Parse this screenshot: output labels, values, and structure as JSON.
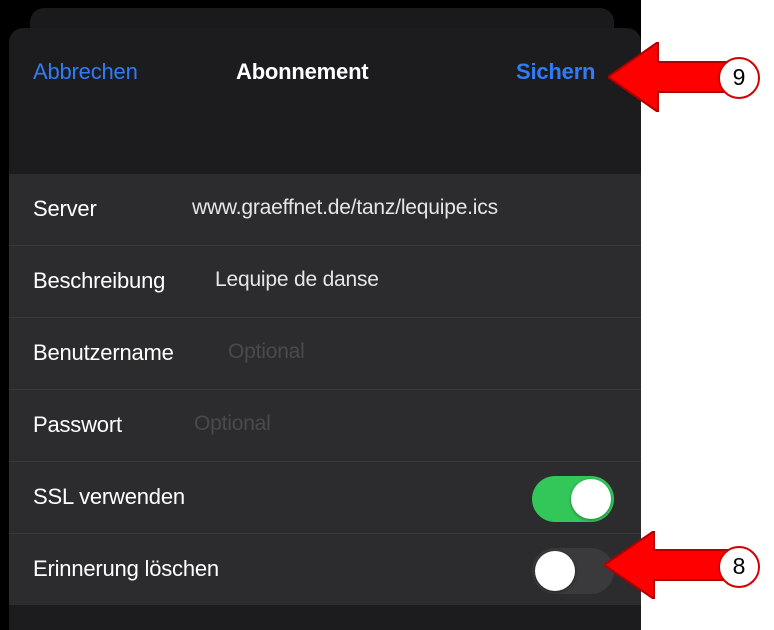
{
  "navbar": {
    "cancel_label": "Abbrechen",
    "title": "Abonnement",
    "save_label": "Sichern"
  },
  "form": {
    "server": {
      "label": "Server",
      "value": "www.graeffnet.de/tanz/lequipe.ics"
    },
    "description": {
      "label": "Beschreibung",
      "value": "Lequipe de danse"
    },
    "username": {
      "label": "Benutzername",
      "value": "",
      "placeholder": "Optional"
    },
    "password": {
      "label": "Passwort",
      "value": "",
      "placeholder": "Optional"
    },
    "ssl": {
      "label": "SSL verwenden",
      "enabled": true
    },
    "remove_alarms": {
      "label": "Erinnerung löschen",
      "enabled": false
    }
  },
  "annotations": {
    "save_callout": "9",
    "toggle_callout": "8"
  },
  "colors": {
    "accent_blue": "#2f7cf6",
    "toggle_on_green": "#33c759",
    "callout_red": "#ff0000"
  }
}
